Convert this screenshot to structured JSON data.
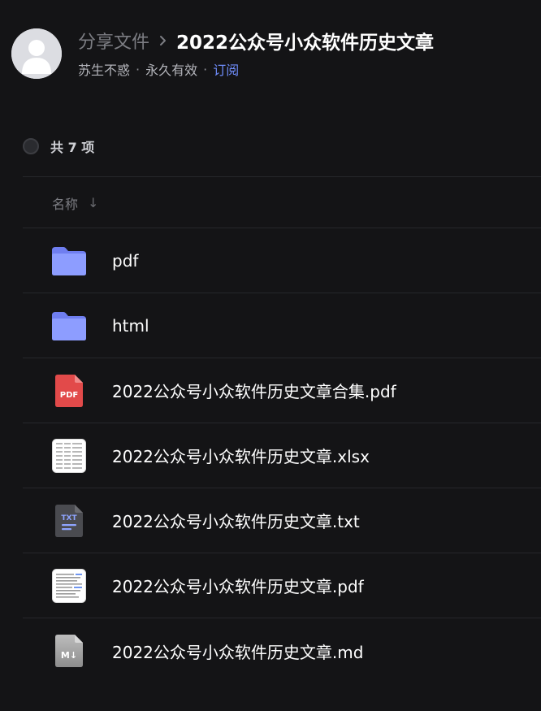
{
  "header": {
    "breadcrumb_parent": "分享文件",
    "breadcrumb_current": "2022公众号小众软件历史文章",
    "author": "苏生不惑",
    "validity": "永久有效",
    "separator": "·",
    "subscribe_label": "订阅"
  },
  "toolbar": {
    "count_label": "共 7 项"
  },
  "columns": {
    "name_label": "名称",
    "sort_icon": "↓"
  },
  "files": [
    {
      "name": "pdf",
      "icon": "folder-icon"
    },
    {
      "name": "html",
      "icon": "folder-icon"
    },
    {
      "name": "2022公众号小众软件历史文章合集.pdf",
      "icon": "pdf-file-icon",
      "icon_text": "PDF"
    },
    {
      "name": "2022公众号小众软件历史文章.xlsx",
      "icon": "spreadsheet-file-icon"
    },
    {
      "name": "2022公众号小众软件历史文章.txt",
      "icon": "txt-file-icon",
      "icon_text": "TXT"
    },
    {
      "name": "2022公众号小众软件历史文章.pdf",
      "icon": "document-thumbnail-icon"
    },
    {
      "name": "2022公众号小众软件历史文章.md",
      "icon": "markdown-file-icon",
      "icon_text": "M↓"
    }
  ],
  "colors": {
    "background": "#141416",
    "accent": "#6f8dfb",
    "folder": "#8a9cff",
    "pdf_red": "#e84d4d",
    "divider": "#26272b"
  }
}
